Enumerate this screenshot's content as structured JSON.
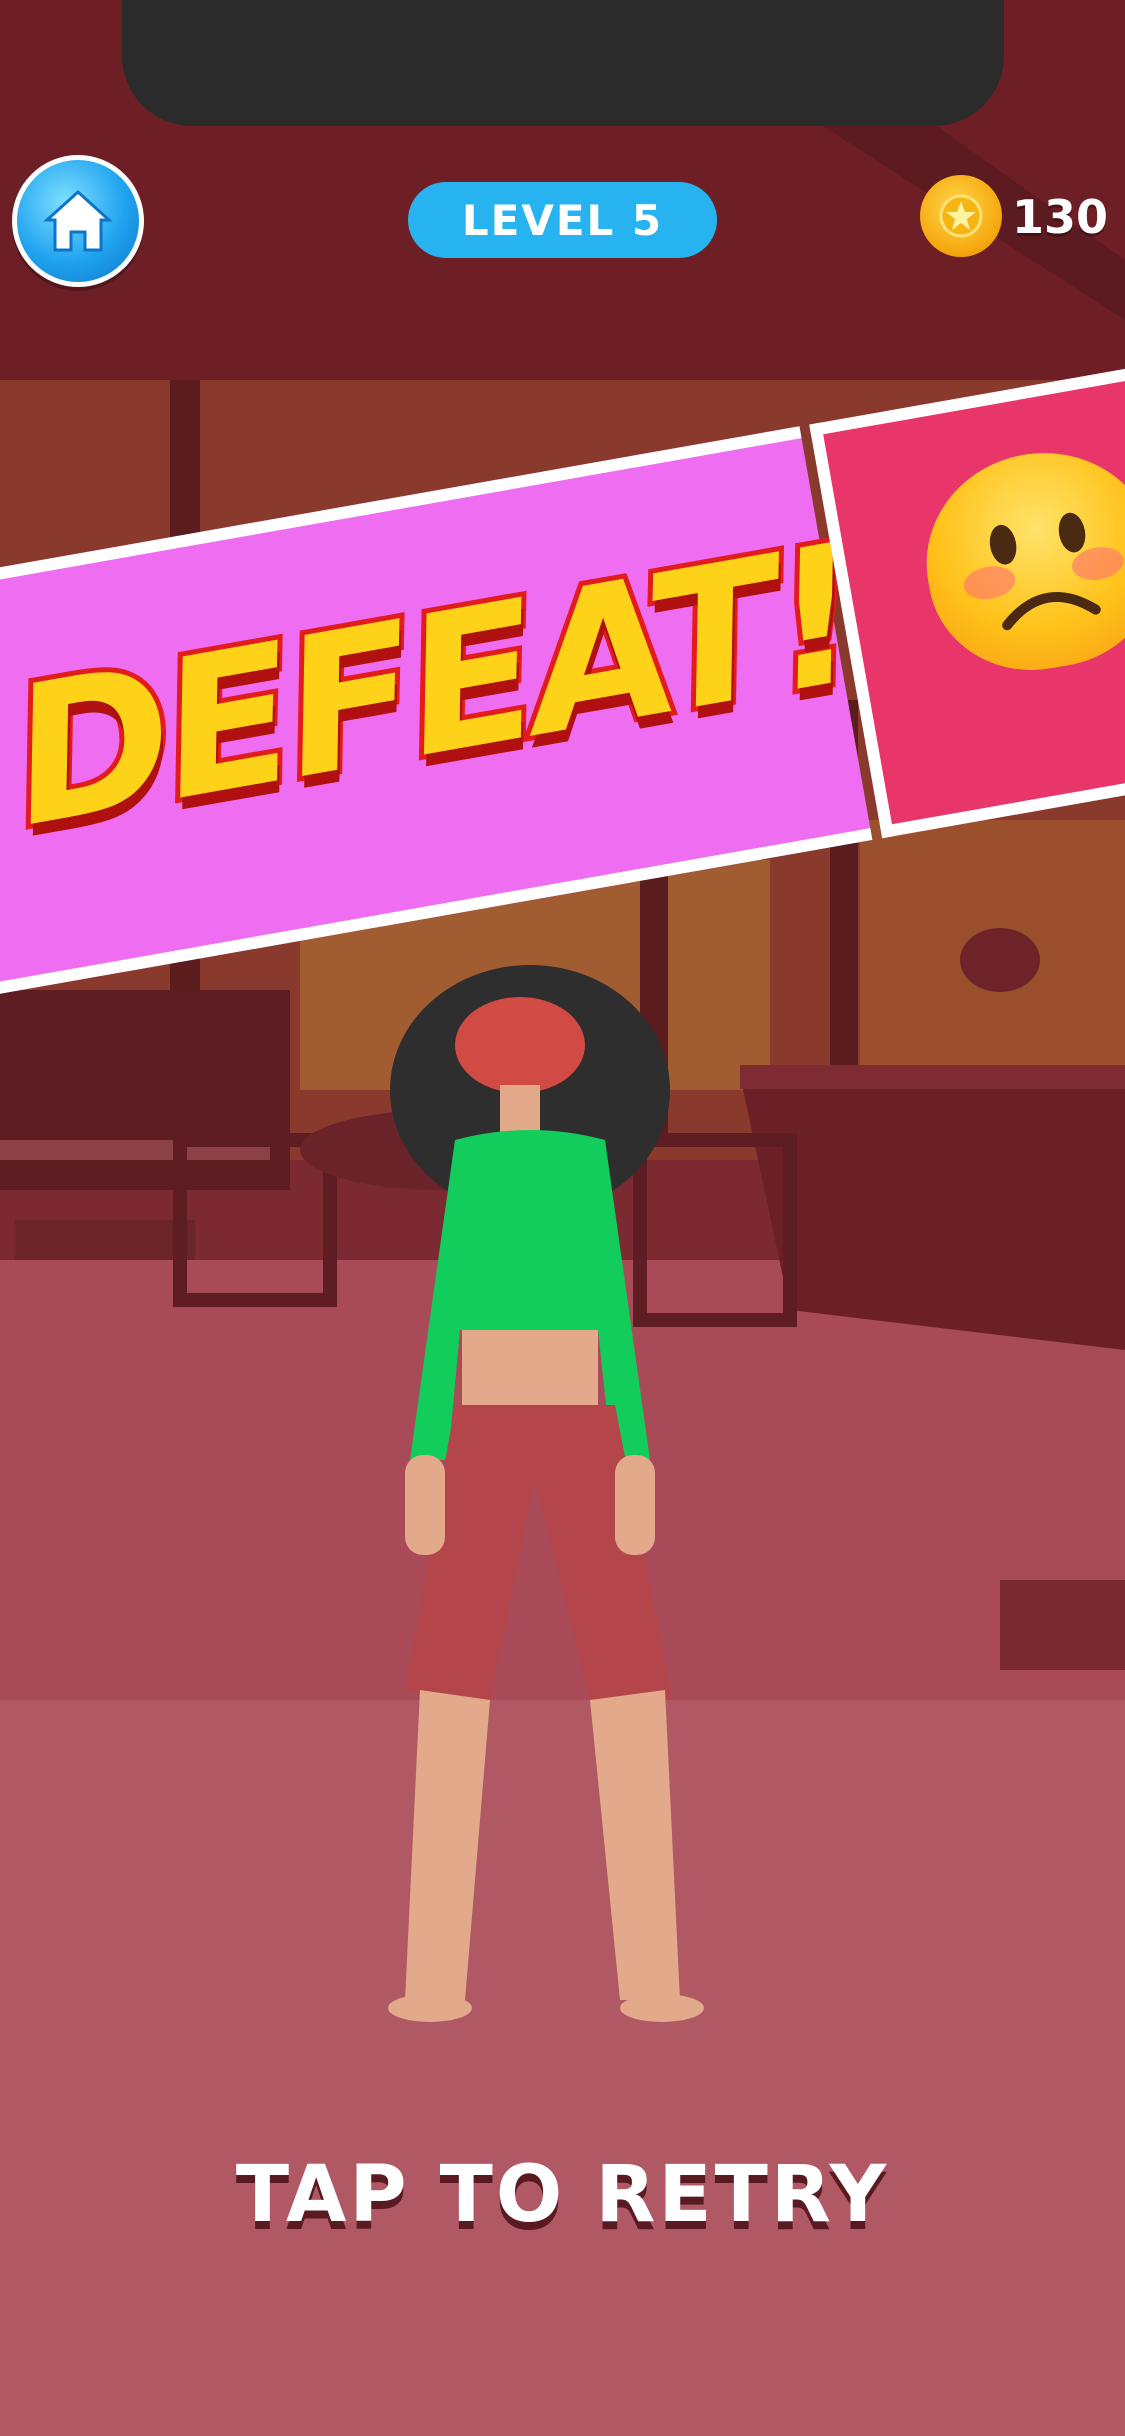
{
  "hud": {
    "home_icon": "home-icon",
    "level_label": "LEVEL 5",
    "coin_icon": "coin-icon",
    "coin_count": "130"
  },
  "banner": {
    "title": "DEFEAT!",
    "emoji": "sad-face-emoji"
  },
  "footer": {
    "retry_label": "TAP TO RETRY"
  },
  "colors": {
    "banner_pink": "#ee6df0",
    "banner_red": "#e8356a",
    "level_pill": "#27b3f0",
    "defeat_fill": "#ffd21a",
    "defeat_stroke": "#e21b1b"
  }
}
